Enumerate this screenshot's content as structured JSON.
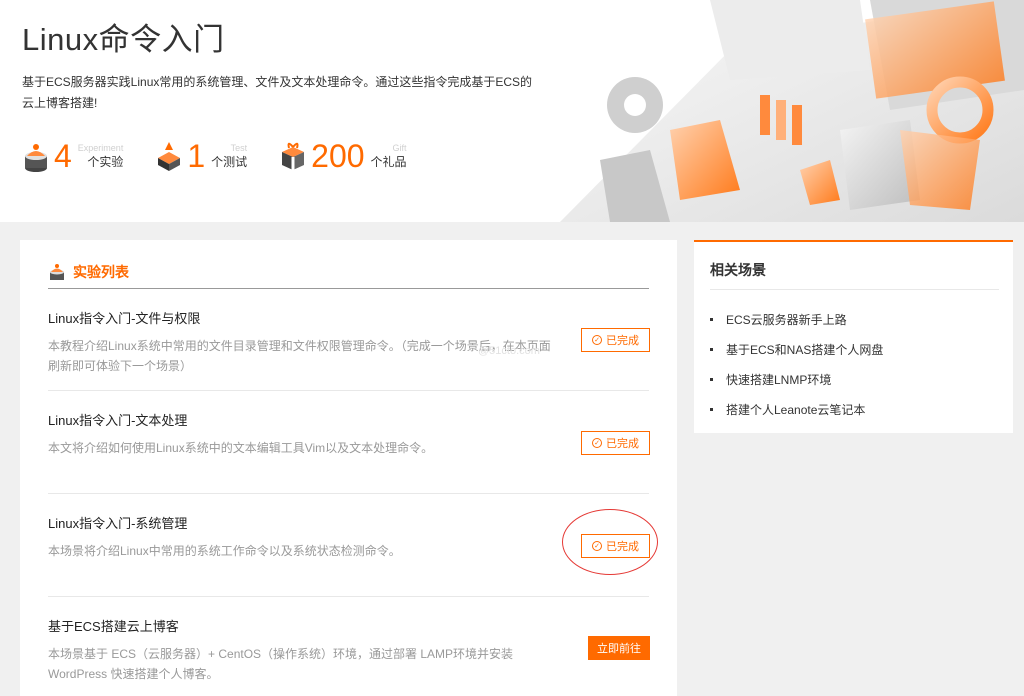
{
  "hero": {
    "title": "Linux命令入门",
    "description": "基于ECS服务器实践Linux常用的系统管理、文件及文本处理命令。通过这些指令完成基于ECS的云上博客搭建!",
    "stats": [
      {
        "number": "4",
        "en": "Experiment",
        "cn": "个实验",
        "icon": "experiment-cake-icon"
      },
      {
        "number": "1",
        "en": "Test",
        "cn": "个测试",
        "icon": "test-stack-icon"
      },
      {
        "number": "200",
        "en": "Gift",
        "cn": "个礼品",
        "icon": "gift-box-icon"
      }
    ]
  },
  "list": {
    "title": "实验列表",
    "items": [
      {
        "title": "Linux指令入门-文件与权限",
        "desc": "本教程介绍Linux系统中常用的文件目录管理和文件权限管理命令。（完成一个场景后，在本页面刷新即可体验下一个场景）",
        "status": "已完成"
      },
      {
        "title": "Linux指令入门-文本处理",
        "desc": "本文将介绍如何使用Linux系统中的文本编辑工具Vim以及文本处理命令。",
        "status": "已完成"
      },
      {
        "title": "Linux指令入门-系统管理",
        "desc": "本场景将介绍Linux中常用的系统工作命令以及系统状态检测命令。",
        "status": "已完成"
      },
      {
        "title": "基于ECS搭建云上博客",
        "desc": "本场景基于 ECS（云服务器）+ CentOS（操作系统）环境，通过部署 LAMP环境并安装 WordPress 快速搭建个人博客。",
        "action": "立即前往"
      }
    ]
  },
  "watermark": "@51cto.com",
  "side": {
    "title": "相关场景",
    "items": [
      "ECS云服务器新手上路",
      "基于ECS和NAS搭建个人网盘",
      "快速搭建LNMP环境",
      "搭建个人Leanote云笔记本"
    ]
  },
  "colors": {
    "accent": "#ff6a00",
    "annotation": "#e53935",
    "background": "#f0f0f0"
  }
}
